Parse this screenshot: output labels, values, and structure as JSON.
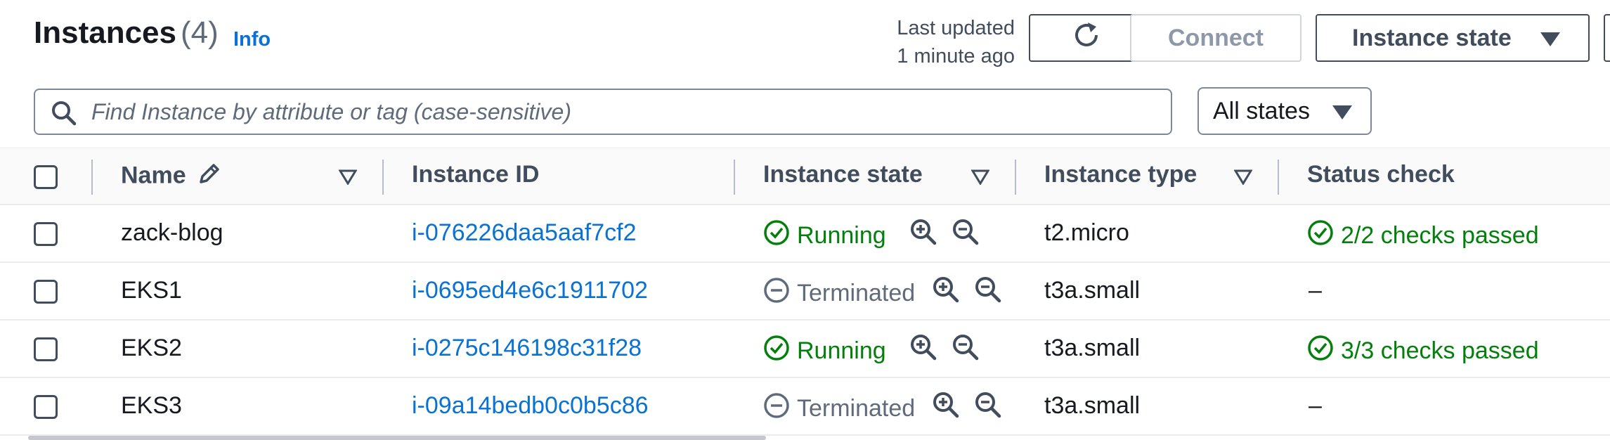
{
  "header": {
    "title": "Instances",
    "count": "(4)",
    "info": "Info",
    "last_updated_line1": "Last updated",
    "last_updated_line2": "1 minute ago",
    "connect_label": "Connect",
    "instance_state_label": "Instance state"
  },
  "search": {
    "placeholder": "Find Instance by attribute or tag (case-sensitive)"
  },
  "filter": {
    "selected": "All states"
  },
  "table": {
    "columns": {
      "name": "Name",
      "instance_id": "Instance ID",
      "instance_state": "Instance state",
      "instance_type": "Instance type",
      "status_check": "Status check"
    },
    "rows": [
      {
        "name": "zack-blog",
        "id": "i-076226daa5aaf7cf2",
        "state": "Running",
        "type": "t2.micro",
        "status": "2/2 checks passed"
      },
      {
        "name": "EKS1",
        "id": "i-0695ed4e6c1911702",
        "state": "Terminated",
        "type": "t3a.small",
        "status": "–"
      },
      {
        "name": "EKS2",
        "id": "i-0275c146198c31f28",
        "state": "Running",
        "type": "t3a.small",
        "status": "3/3 checks passed"
      },
      {
        "name": "EKS3",
        "id": "i-09a14bedb0c0b5c86",
        "state": "Terminated",
        "type": "t3a.small",
        "status": "–"
      }
    ]
  },
  "icons": {
    "refresh": "refresh-icon",
    "search": "search-icon",
    "edit": "pencil-icon",
    "sort": "sort-caret-icon",
    "running": "check-circle-icon",
    "terminated": "minus-circle-icon",
    "zoom_in": "zoom-in-icon",
    "zoom_out": "zoom-out-icon"
  },
  "colors": {
    "link": "#0972d3",
    "success": "#037f0c",
    "muted": "#5f6b7a",
    "text": "#16191f"
  }
}
